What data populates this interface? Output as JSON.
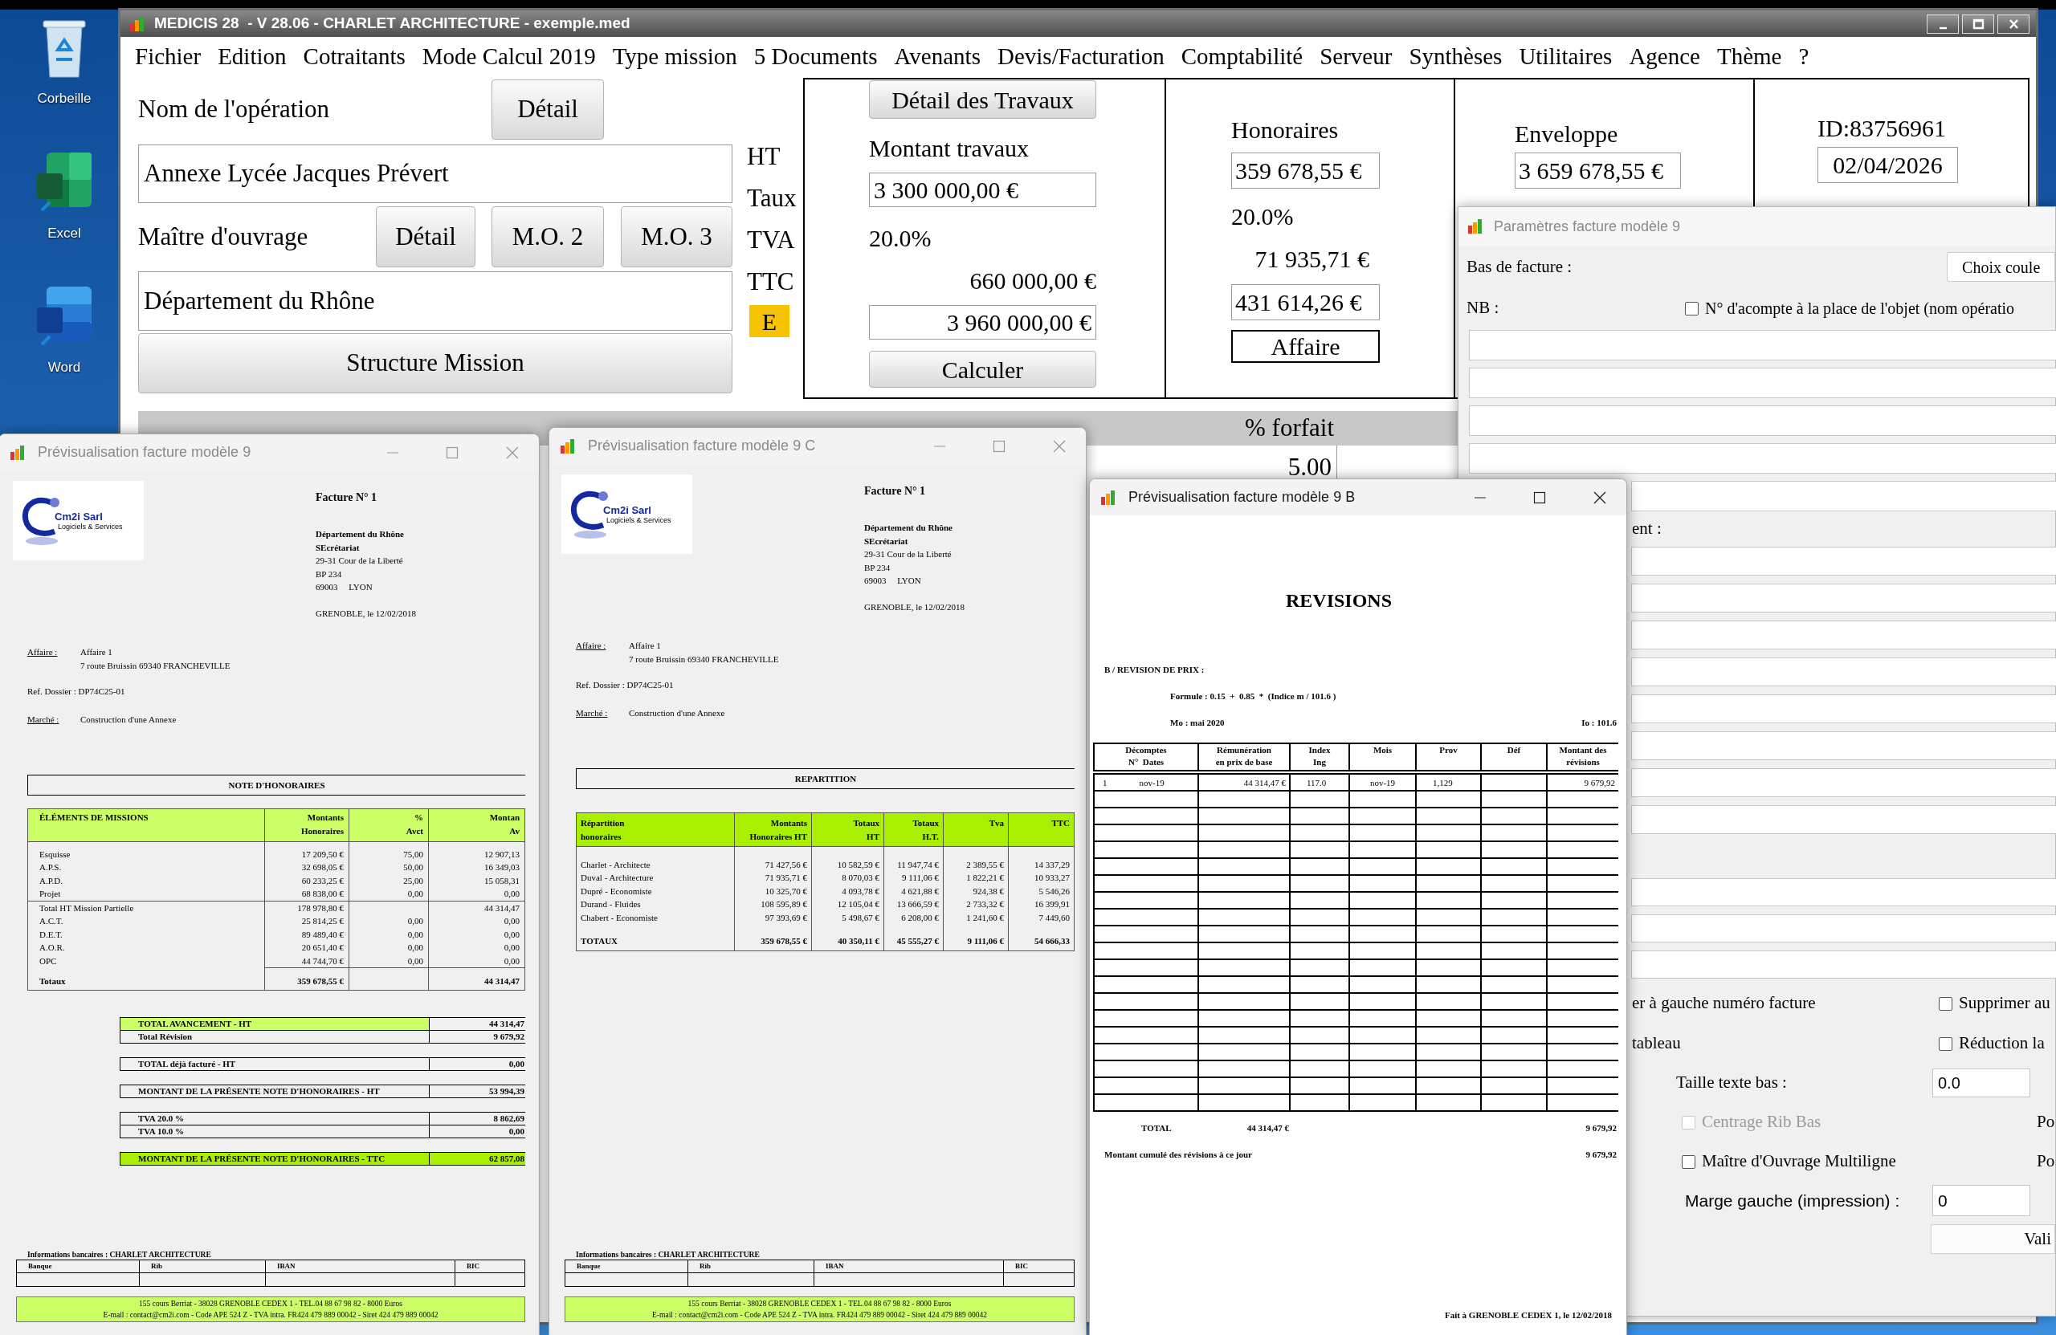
{
  "desktop_icons": [
    {
      "kind": "recycle",
      "label": "Corbeille"
    },
    {
      "kind": "excel",
      "label": "Excel"
    },
    {
      "kind": "word",
      "label": "Word"
    }
  ],
  "main_window": {
    "title": "MEDICIS 28  - V 28.06 - CHARLET ARCHITECTURE - exemple.med",
    "menu": [
      "Fichier",
      "Edition",
      "Cotraitants",
      "Mode Calcul 2019",
      "Type mission",
      "5 Documents",
      "Avenants",
      "Devis/Facturation",
      "Comptabilité",
      "Serveur",
      "Synthèses",
      "Utilitaires",
      "Agence",
      "Thème",
      "?"
    ],
    "operation_label": "Nom de l'opération",
    "operation_button": "Détail",
    "operation_name": "Annexe Lycée Jacques Prévert",
    "owner_label": "Maître d'ouvrage",
    "owner_buttons": [
      "Détail",
      "M.O. 2",
      "M.O. 3"
    ],
    "owner_name": "Département du Rhône",
    "structure_button": "Structure Mission",
    "tax_labels": [
      "HT",
      "Taux",
      "TVA",
      "TTC"
    ],
    "badge": "E",
    "travaux": {
      "button": "Détail des Travaux",
      "label": "Montant travaux",
      "amount": "3 300 000,00 €",
      "rate": "20.0%",
      "tva": "660 000,00 €",
      "ttc": "3 960 000,00 €",
      "calc_button": "Calculer"
    },
    "honoraires": {
      "label": "Honoraires",
      "amount": "359 678,55 €",
      "rate": "20.0%",
      "tva": "71 935,71 €",
      "ttc": "431 614,26 €",
      "button": "Affaire"
    },
    "enveloppe": {
      "label": "Enveloppe",
      "amount": "3 659 678,55 €"
    },
    "ident": {
      "id": "ID:83756961",
      "date": "02/04/2026"
    },
    "grid": {
      "header": "% forfait",
      "cell": "5.00"
    }
  },
  "params_window": {
    "title": "Paramètres facture modèle 9",
    "active": false,
    "footer_label": "Bas de facture :",
    "color_button": "Choix coule",
    "nb_label": "NB :",
    "acompte_option": {
      "label": "N° d'acompte à la place de l'objet (nom opératio",
      "checked": false
    },
    "section_label": "ent :",
    "invoice_number_text": "er à gauche numéro facture",
    "remove_option": {
      "label": "Supprimer au",
      "checked": false
    },
    "table_text": "tableau",
    "reduce_option": {
      "label": "Réduction la",
      "checked": false
    },
    "text_size": {
      "label": "Taille texte bas :",
      "value": "0.0"
    },
    "rib_option": {
      "label": "Centrage Rib Bas",
      "checked": false,
      "disabled": true
    },
    "rib_side": "Po",
    "owner_option": {
      "label": "Maître d'Ouvrage Multiligne",
      "checked": false,
      "disabled": false
    },
    "owner_side": "Po",
    "margin": {
      "label": "Marge gauche (impression) :",
      "value": "0"
    },
    "validate_button": "Vali"
  },
  "preview_windows": [
    {
      "kind": "honoraires",
      "title": "Prévisualisation facture modèle 9",
      "active": false,
      "logo": {
        "name": "Cm2i Sarl",
        "tagline": "Logiciels & Services"
      },
      "invoice_title": "Facture N° 1",
      "recipient": {
        "name": "Département du Rhône",
        "service": "SEcrétariat",
        "address": [
          "29-31 Cour de la Liberté",
          "BP 234",
          "69003     LYON"
        ]
      },
      "place_date": "GRENOBLE, le 12/02/2018",
      "affaire_label": "Affaire :",
      "affaire": [
        "Affaire 1",
        "7 route Bruissin 69340 FRANCHEVILLE"
      ],
      "ref_dossier": "Ref. Dossier : DP74C25-01",
      "marche_label": "Marché :",
      "marche": "Construction d'une Annexe",
      "section_title": "NOTE D'HONORAIRES",
      "columns": [
        "ÉLÉMENTS DE MISSIONS",
        "Montants\nHonoraires",
        "%\nAvct",
        "Montan\nAv"
      ],
      "rows": [
        {
          "kind": "line",
          "label": "Esquisse",
          "amount": "17 209,50 €",
          "percent": "75,00",
          "value": "12 907,13"
        },
        {
          "kind": "line",
          "label": "A.P.S.",
          "amount": "32 698,05 €",
          "percent": "50,00",
          "value": "16 349,03"
        },
        {
          "kind": "line",
          "label": "A.P.D.",
          "amount": "60 233,25 €",
          "percent": "25,00",
          "value": "15 058,31"
        },
        {
          "kind": "line",
          "label": "Projet",
          "amount": "68 838,00 €",
          "percent": "0,00",
          "value": "0,00"
        },
        {
          "kind": "subtotal",
          "label": "Total HT Mission Partielle",
          "amount": "178 978,80 €",
          "value": "44 314,47"
        },
        {
          "kind": "line",
          "label": "A.C.T.",
          "amount": "25 814,25 €",
          "percent": "0,00",
          "value": "0,00"
        },
        {
          "kind": "line",
          "label": "D.E.T.",
          "amount": "89 489,40 €",
          "percent": "0,00",
          "value": "0,00"
        },
        {
          "kind": "line",
          "label": "A.O.R.",
          "amount": "20 651,40 €",
          "percent": "0,00",
          "value": "0,00"
        },
        {
          "kind": "line",
          "label": "OPC",
          "amount": "44 744,70 €",
          "percent": "0,00",
          "value": "0,00"
        },
        {
          "kind": "total",
          "label": "Totaux",
          "amount": "359 678,55 €",
          "value": "44 314,47"
        }
      ],
      "summary": [
        [
          {
            "label": "TOTAL AVANCEMENT - HT",
            "value": "44 314,47",
            "label_highlighted": true,
            "value_highlighted": false
          },
          {
            "label": "Total Révision",
            "value": "9 679,92",
            "label_highlighted": false,
            "value_highlighted": false
          }
        ],
        [
          {
            "label": "TOTAL déjà facturé - HT",
            "value": "0,00",
            "label_highlighted": false,
            "value_highlighted": false
          }
        ],
        [
          {
            "label": "MONTANT DE LA PRÉSENTE NOTE D'HONORAIRES - HT",
            "value": "53 994,39",
            "label_highlighted": false,
            "value_highlighted": false
          }
        ],
        [
          {
            "label": "TVA 20.0 %",
            "value": "8 862,69",
            "label_highlighted": false,
            "value_highlighted": false
          },
          {
            "label": "TVA 10.0 %",
            "value": "0,00",
            "label_highlighted": false,
            "value_highlighted": false
          }
        ],
        [
          {
            "label": "MONTANT DE LA PRÉSENTE NOTE D'HONORAIRES - TTC",
            "value": "62 857,08",
            "label_highlighted": true,
            "value_highlighted": true
          }
        ]
      ],
      "bank_title": "Informations bancaires : CHARLET ARCHITECTURE",
      "bank_columns": [
        "Banque",
        "Rib",
        "IBAN",
        "BIC"
      ],
      "footer": [
        "155 cours Berriat - 38028 GRENOBLE CEDEX 1 - TEL.04 88 67 98 82 - 8000 Euros",
        "E-mail : contact@cm2i.com - Code APE 524 Z - TVA intra. FR424 479 889 00042 - Siret 424 479 889 00042"
      ]
    },
    {
      "kind": "repartition",
      "title": "Prévisualisation facture modèle 9 C",
      "active": false,
      "logo": {
        "name": "Cm2i Sarl",
        "tagline": "Logiciels & Services"
      },
      "invoice_title": "Facture N° 1",
      "recipient": {
        "name": "Département du Rhône",
        "service": "SEcrétariat",
        "address": [
          "29-31 Cour de la Liberté",
          "BP 234",
          "69003     LYON"
        ]
      },
      "place_date": "GRENOBLE, le 12/02/2018",
      "affaire_label": "Affaire :",
      "affaire": [
        "Affaire 1",
        "7 route Bruissin 69340 FRANCHEVILLE"
      ],
      "ref_dossier": "Ref. Dossier : DP74C25-01",
      "marche_label": "Marché :",
      "marche": "Construction d'une Annexe",
      "section_title": "REPARTITION",
      "columns": [
        "Répartition\nhonoraires",
        "Montants\nHonoraires HT",
        "Totaux\nHT",
        "Totaux\nH.T.",
        "Tva",
        "TTC"
      ],
      "rows": [
        {
          "kind": "line",
          "cells": [
            "Charlet - Architecte",
            "71 427,56 €",
            "10 582,59 €",
            "11 947,74 €",
            "2 389,55 €",
            "14 337,29"
          ]
        },
        {
          "kind": "line",
          "cells": [
            "Duval - Architecture",
            "71 935,71 €",
            "8 070,03 €",
            "9 111,06 €",
            "1 822,21 €",
            "10 933,27"
          ]
        },
        {
          "kind": "line",
          "cells": [
            "Dupré - Economiste",
            "10 325,70 €",
            "4 093,78 €",
            "4 621,88 €",
            "924,38 €",
            "5 546,26"
          ]
        },
        {
          "kind": "line",
          "cells": [
            "Durand - Fluides",
            "108 595,89 €",
            "12 105,04 €",
            "13 666,59 €",
            "2 733,32 €",
            "16 399,91"
          ]
        },
        {
          "kind": "line",
          "cells": [
            "Chabert - Economiste",
            "97 393,69 €",
            "5 498,67 €",
            "6 208,00 €",
            "1 241,60 €",
            "7 449,60"
          ]
        },
        {
          "kind": "total",
          "cells": [
            "TOTAUX",
            "359 678,55 €",
            "40 350,11 €",
            "45 555,27 €",
            "9 111,06 €",
            "54 666,33"
          ]
        }
      ],
      "bank_title": "Informations bancaires : CHARLET ARCHITECTURE",
      "bank_columns": [
        "Banque",
        "Rib",
        "IBAN",
        "BIC"
      ],
      "footer": [
        "155 cours Berriat - 38028 GRENOBLE CEDEX 1 - TEL.04 88 67 98 82 - 8000 Euros",
        "E-mail : contact@cm2i.com - Code APE 524 Z - TVA intra. FR424 479 889 00042 - Siret 424 479 889 00042"
      ]
    },
    {
      "kind": "revisions",
      "title": "Prévisualisation facture modèle 9 B",
      "active": true,
      "heading": "REVISIONS",
      "section": "B / REVISION DE PRIX :",
      "formula": "Formule : 0.15  +  0.85  *  (Indice m / 101.6 )",
      "mo": "Mo : mai 2020",
      "io": "Io : 101.6",
      "columns": [
        "Décomptes\nN°  Dates",
        "Rémunération\nen prix de base",
        "Index\nIng",
        "Mois",
        "Prov",
        "Déf",
        "Montant des\nrévisions"
      ],
      "rows": [
        {
          "number": "1",
          "date": "nov-19",
          "base": "44 314,47 €",
          "index": "117.0",
          "month": "nov-19",
          "prov": "1,129",
          "amount": "9 679,92"
        }
      ],
      "total_label": "TOTAL",
      "total_base": "44 314,47 €",
      "total_amount": "9 679,92",
      "cumul_label": "Montant cumulé des révisions à ce jour",
      "cumul_amount": "9 679,92",
      "signature": "Fait à GRENOBLE CEDEX 1, le 12/02/2018"
    }
  ]
}
